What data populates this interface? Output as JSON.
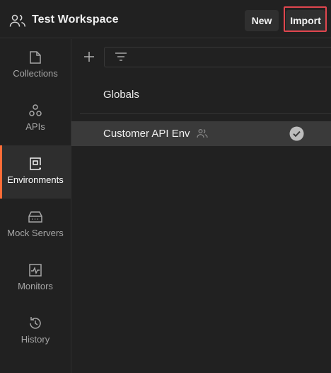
{
  "header": {
    "workspace_title": "Test Workspace",
    "new_label": "New",
    "import_label": "Import",
    "workspace_icon": "team-icon"
  },
  "sidebar": {
    "items": [
      {
        "label": "Collections",
        "icon": "collections-icon",
        "active": false
      },
      {
        "label": "APIs",
        "icon": "apis-icon",
        "active": false
      },
      {
        "label": "Environments",
        "icon": "environments-icon",
        "active": true
      },
      {
        "label": "Mock Servers",
        "icon": "mock-servers-icon",
        "active": false
      },
      {
        "label": "Monitors",
        "icon": "monitors-icon",
        "active": false
      },
      {
        "label": "History",
        "icon": "history-icon",
        "active": false
      }
    ]
  },
  "main": {
    "filter_placeholder": "",
    "globals_label": "Globals",
    "environments": [
      {
        "name": "Customer API Env",
        "shared": true,
        "active": true
      }
    ]
  },
  "colors": {
    "background": "#212121",
    "accent": "#ff6c37",
    "highlight": "#e0464e",
    "selected_row": "#3a3a3a"
  }
}
